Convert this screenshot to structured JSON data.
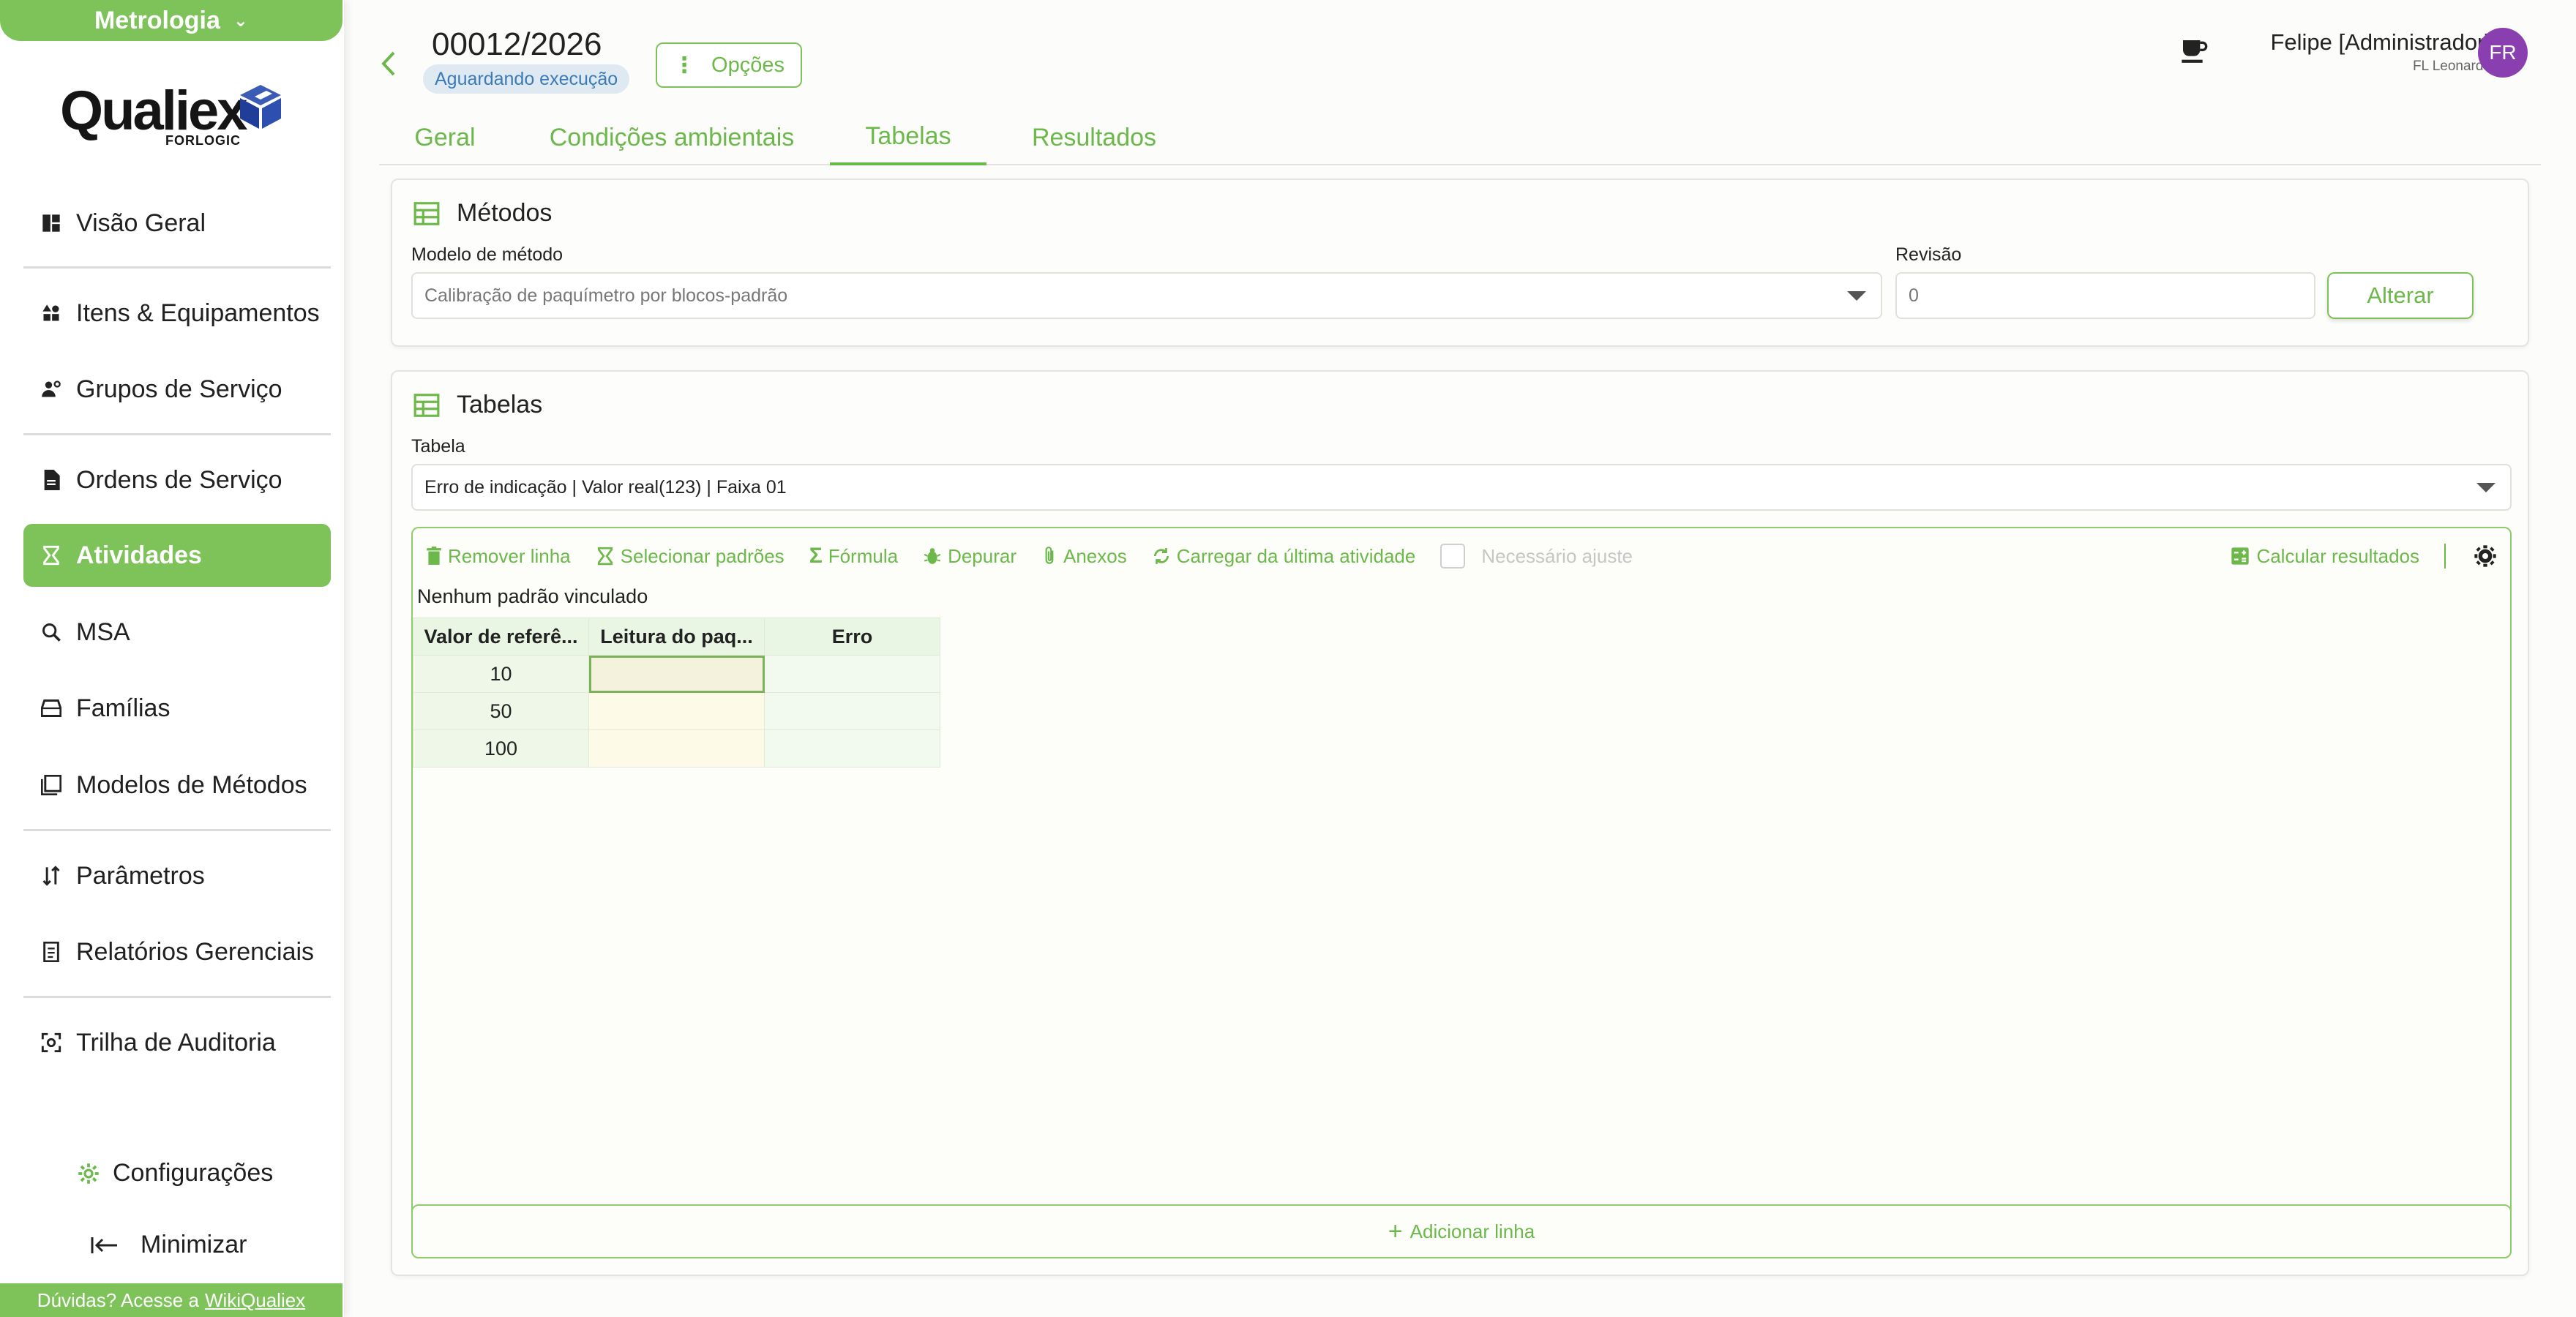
{
  "sidebar": {
    "module": "Metrologia",
    "logo_word": "Qualiex",
    "logo_sub": "FORLOGIC",
    "items": [
      {
        "label": "Visão Geral",
        "icon": "dashboard-icon"
      },
      {
        "label": "Itens & Equipamentos",
        "icon": "shapes-icon"
      },
      {
        "label": "Grupos de Serviço",
        "icon": "users-gear-icon"
      },
      {
        "label": "Ordens de Serviço",
        "icon": "document-icon"
      },
      {
        "label": "Atividades",
        "icon": "hourglass-icon"
      },
      {
        "label": "MSA",
        "icon": "zoom-icon"
      },
      {
        "label": "Famílias",
        "icon": "inbox-icon"
      },
      {
        "label": "Modelos de Métodos",
        "icon": "book-icon"
      },
      {
        "label": "Parâmetros",
        "icon": "sort-icon"
      },
      {
        "label": "Relatórios Gerenciais",
        "icon": "report-icon"
      },
      {
        "label": "Trilha de Auditoria",
        "icon": "audit-icon"
      }
    ],
    "config_label": "Configurações",
    "minimize_label": "Minimizar",
    "help_text": "Dúvidas? Acesse a",
    "help_link": "WikiQualiex"
  },
  "header": {
    "title": "00012/2026",
    "status": "Aguardando execução",
    "options_label": "Opções",
    "user_name": "Felipe [Administrador]",
    "user_sub": "FL Leonardo",
    "avatar_initials": "FR"
  },
  "tabs": [
    "Geral",
    "Condições ambientais",
    "Tabelas",
    "Resultados"
  ],
  "methods": {
    "title": "Métodos",
    "model_label": "Modelo de método",
    "model_value": "Calibração de paquímetro por blocos-padrão",
    "revision_label": "Revisão",
    "revision_placeholder": "0",
    "alter_label": "Alterar"
  },
  "tables": {
    "title": "Tabelas",
    "table_label": "Tabela",
    "table_value": "Erro de indicação | Valor real(123) | Faixa 01",
    "toolbar": {
      "remove_row": "Remover linha",
      "select_standards": "Selecionar padrões",
      "formula": "Fórmula",
      "debug": "Depurar",
      "attachments": "Anexos",
      "load_last": "Carregar da última atividade",
      "adjust_needed": "Necessário ajuste",
      "calc_results": "Calcular resultados"
    },
    "no_standard": "Nenhum padrão vinculado",
    "columns": [
      "Valor de referê...",
      "Leitura do paq...",
      "Erro"
    ],
    "rows": [
      {
        "ref": "10",
        "read": "",
        "err": ""
      },
      {
        "ref": "50",
        "read": "",
        "err": ""
      },
      {
        "ref": "100",
        "read": "",
        "err": ""
      }
    ],
    "add_row": "Adicionar linha"
  },
  "colors": {
    "accent": "#7ec35a",
    "avatar": "#8a3fb0",
    "badge_bg": "#dfe9f2"
  }
}
